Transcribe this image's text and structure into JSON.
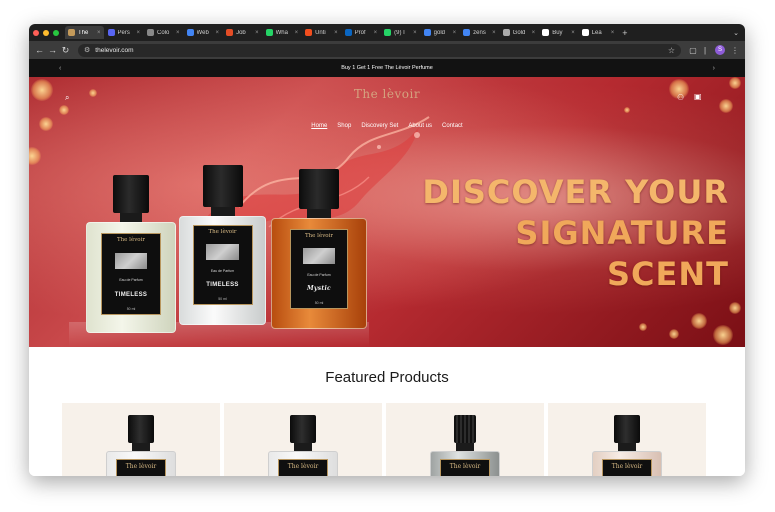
{
  "browser": {
    "tabs": [
      {
        "title": "The",
        "color": "#c49a5a",
        "active": true
      },
      {
        "title": "Pers",
        "color": "#5865f2"
      },
      {
        "title": "Colo",
        "color": "#888888"
      },
      {
        "title": "Web",
        "color": "#4285f4"
      },
      {
        "title": "Job",
        "color": "#e44d26"
      },
      {
        "title": "Wha",
        "color": "#25d366"
      },
      {
        "title": "Unti",
        "color": "#f24e1e"
      },
      {
        "title": "Prof",
        "color": "#0a66c2"
      },
      {
        "title": "(9) I",
        "color": "#25d366"
      },
      {
        "title": "gold",
        "color": "#4285f4"
      },
      {
        "title": "zens",
        "color": "#4285f4"
      },
      {
        "title": "Gold",
        "color": "#aaaaaa"
      },
      {
        "title": "Buy",
        "color": "#ffffff"
      },
      {
        "title": "Lea",
        "color": "#ffffff"
      }
    ],
    "close_glyph": "×",
    "new_tab_glyph": "+",
    "url": "thelevoir.com",
    "profile_initial": "S"
  },
  "announcement": {
    "text": "Buy 1 Get 1 Free The Lèvoir Perfume",
    "prev": "‹",
    "next": "›"
  },
  "header": {
    "logo": "The lèvoir",
    "nav": [
      {
        "label": "Home",
        "active": true
      },
      {
        "label": "Shop"
      },
      {
        "label": "Discovery Set"
      },
      {
        "label": "About us"
      },
      {
        "label": "Contact"
      }
    ]
  },
  "hero": {
    "headline_line1": "DISCOVER YOUR",
    "headline_line2": "SIGNATURE SCENT",
    "bottles": [
      {
        "brand": "The lèvoir",
        "type": "Eau de Parfum",
        "name": "TIMELESS",
        "ml": "50 ml",
        "liquid": "#e9ecd9"
      },
      {
        "brand": "The lèvoir",
        "type": "Eau de Parfum",
        "name": "TIMELESS",
        "ml": "50 ml",
        "liquid": "#eef0f0"
      },
      {
        "brand": "The lèvoir",
        "type": "Eau de Parfum",
        "name": "Mystic",
        "ml": "50 ml",
        "liquid": "#d86a1c"
      }
    ]
  },
  "featured": {
    "title": "Featured Products",
    "product_brand": "The lèvoir"
  },
  "colors": {
    "accent_gold": "#f4b66b",
    "hero_red": "#b52a30",
    "announcement_bg": "#121212"
  }
}
